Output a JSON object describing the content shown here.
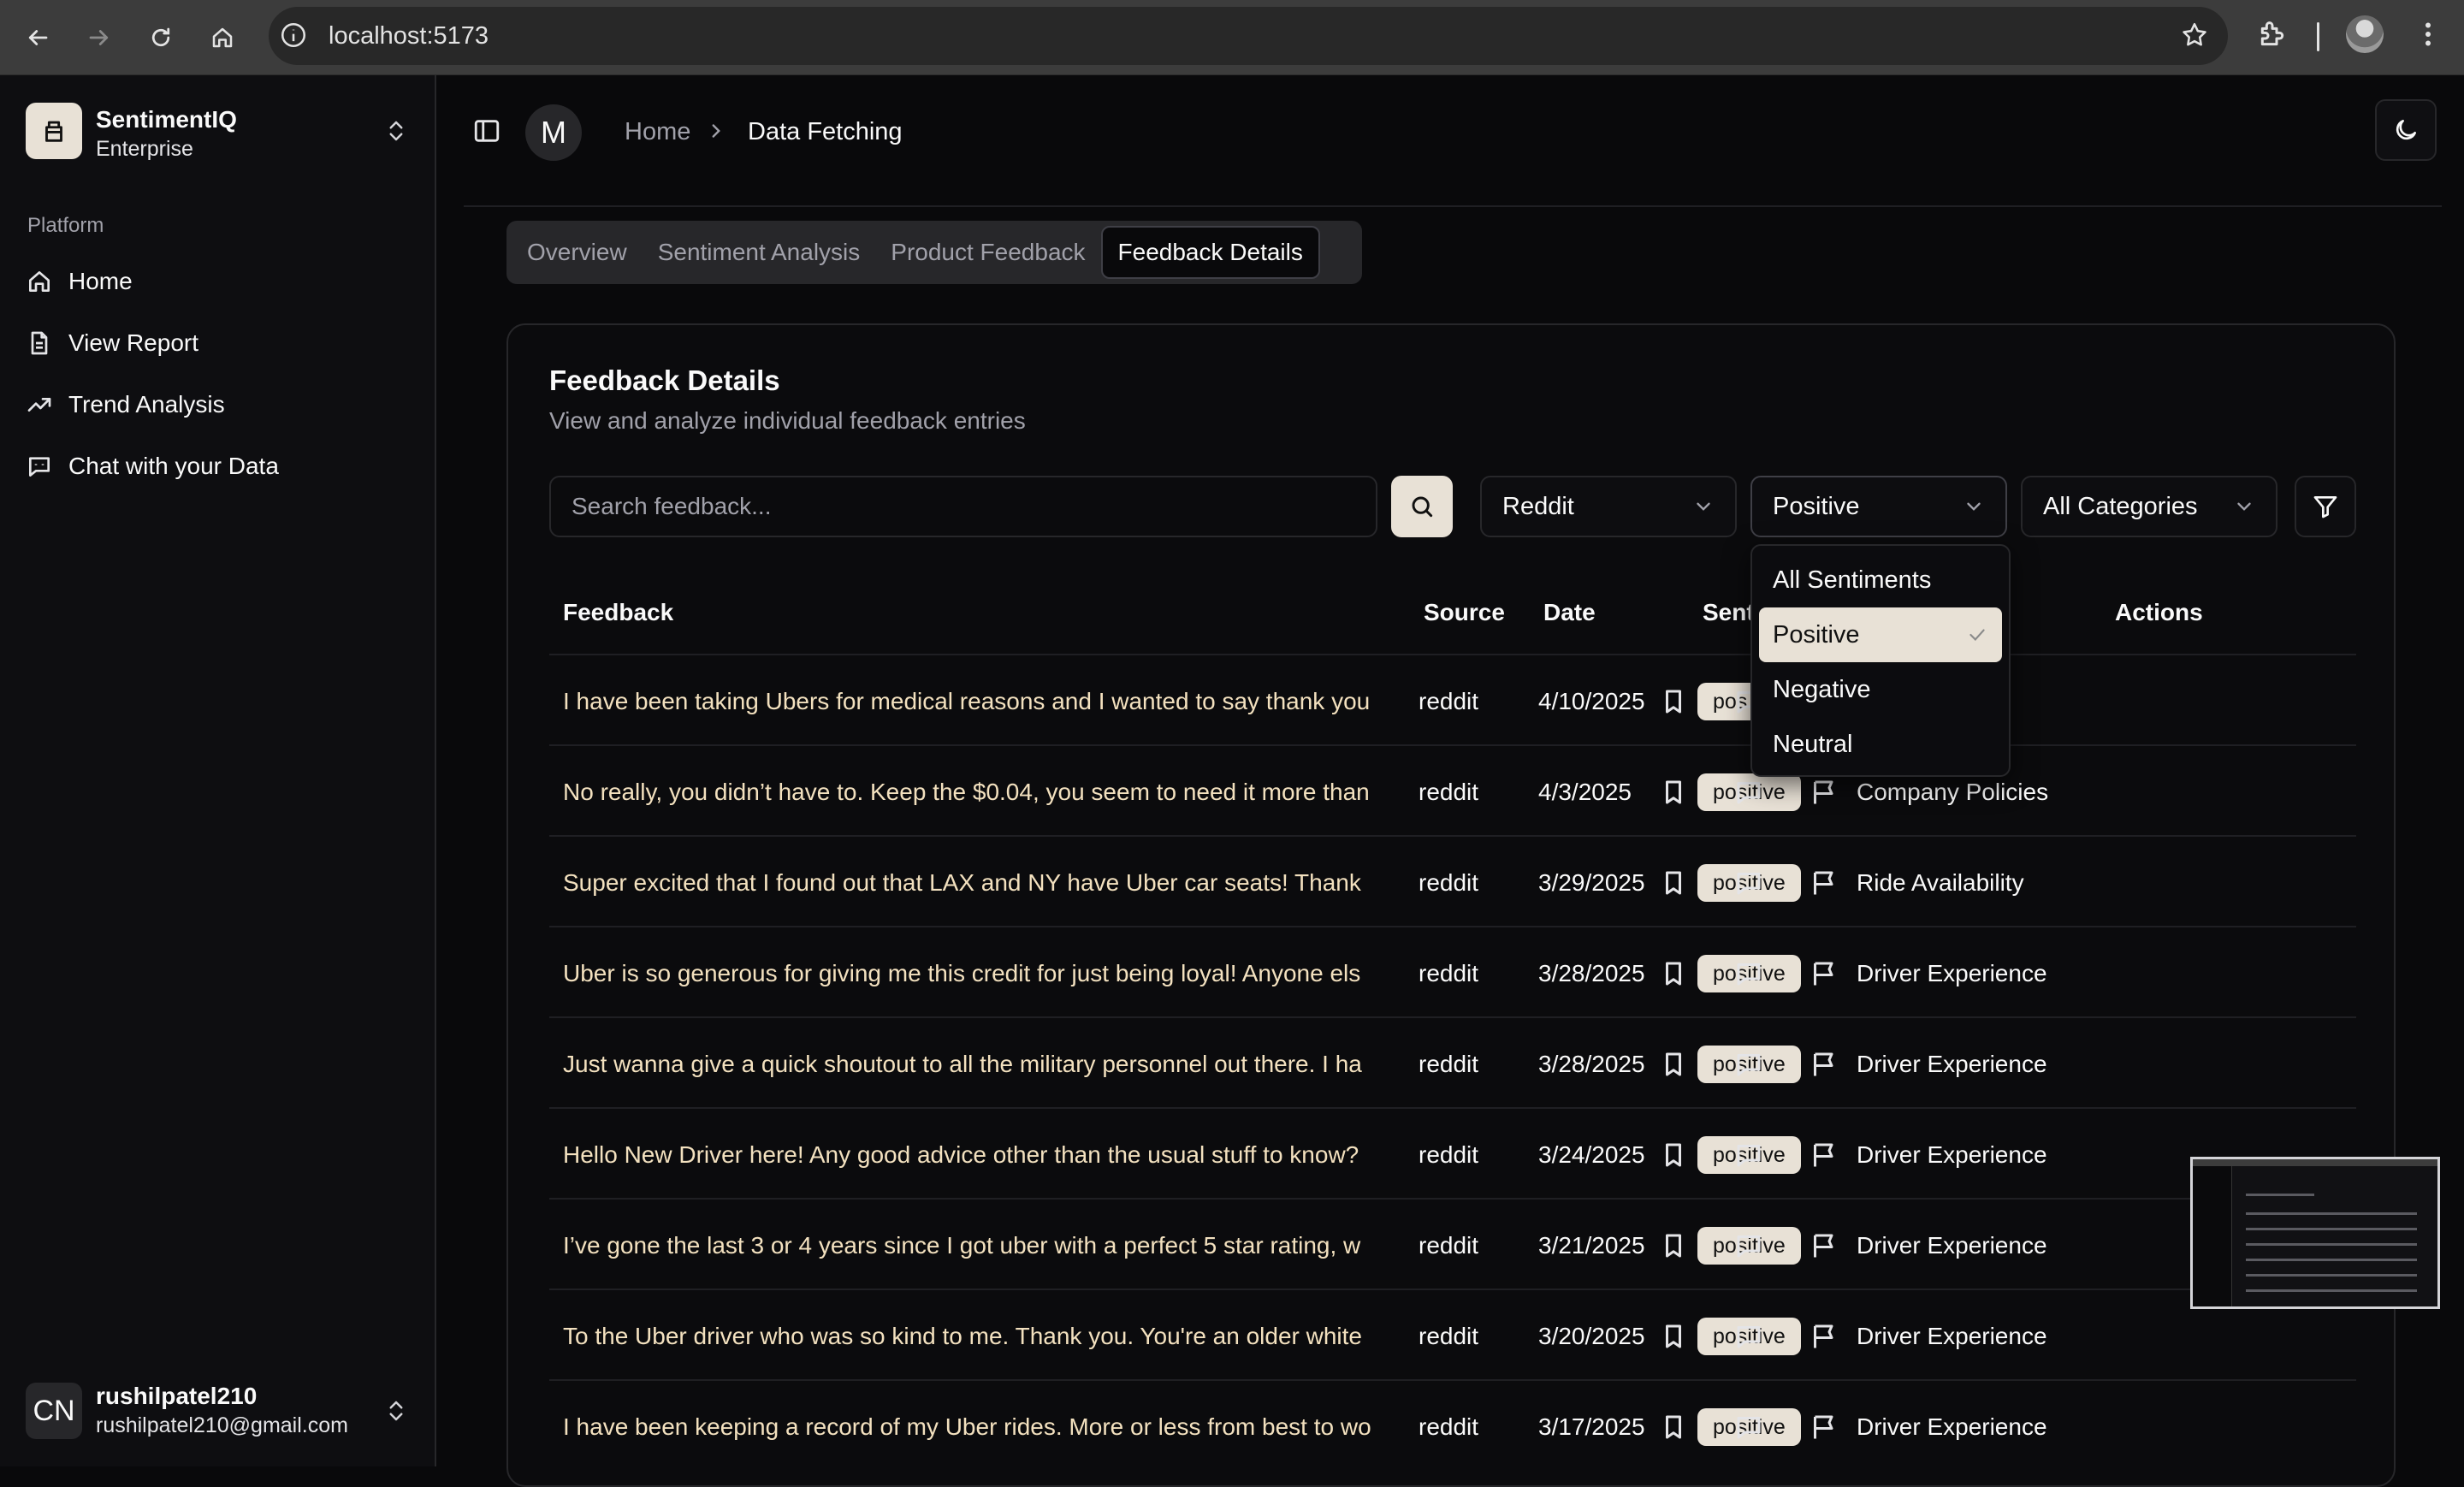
{
  "browser": {
    "url": "localhost:5173"
  },
  "sidebar": {
    "brand_name": "SentimentIQ",
    "brand_plan": "Enterprise",
    "group_label": "Platform",
    "items": [
      {
        "label": "Home",
        "icon": "home-icon"
      },
      {
        "label": "View Report",
        "icon": "file-text-icon"
      },
      {
        "label": "Trend Analysis",
        "icon": "trending-up-icon"
      },
      {
        "label": "Chat with your Data",
        "icon": "bot-message-icon"
      }
    ],
    "user": {
      "initials": "CN",
      "name": "rushilpatel210",
      "email": "rushilpatel210@gmail.com"
    }
  },
  "header": {
    "avatar_letter": "M",
    "breadcrumb_home": "Home",
    "breadcrumb_current": "Data Fetching"
  },
  "tabs": [
    "Overview",
    "Sentiment Analysis",
    "Product Feedback",
    "Feedback Details"
  ],
  "active_tab": "Feedback Details",
  "card": {
    "title": "Feedback Details",
    "subtitle": "View and analyze individual feedback entries"
  },
  "filters": {
    "search_placeholder": "Search feedback...",
    "source": "Reddit",
    "sentiment": "Positive",
    "category": "All Categories"
  },
  "sentiment_dropdown": {
    "options": [
      "All Sentiments",
      "Positive",
      "Negative",
      "Neutral"
    ],
    "selected": "Positive"
  },
  "table": {
    "headers": {
      "feedback": "Feedback",
      "source": "Source",
      "date": "Date",
      "sentiment": "Sent",
      "category_tail": "",
      "actions": "Actions"
    },
    "rows": [
      {
        "feedback": "I have been taking Ubers for medical reasons and I wanted to say thank you",
        "source": "reddit",
        "date": "4/10/2025",
        "sentiment": "pos",
        "category": "ence"
      },
      {
        "feedback": "No really, you didn’t have to. Keep the $0.04, you seem to need it more than",
        "source": "reddit",
        "date": "4/3/2025",
        "sentiment": "positive",
        "category": "Company Policies"
      },
      {
        "feedback": "Super excited that I found out that LAX and NY have Uber car seats! Thank",
        "source": "reddit",
        "date": "3/29/2025",
        "sentiment": "positive",
        "category": "Ride Availability"
      },
      {
        "feedback": "Uber is so generous for giving me this credit for just being loyal! Anyone els",
        "source": "reddit",
        "date": "3/28/2025",
        "sentiment": "positive",
        "category": "Driver Experience"
      },
      {
        "feedback": "Just wanna give a quick shoutout to all the military personnel out there. I ha",
        "source": "reddit",
        "date": "3/28/2025",
        "sentiment": "positive",
        "category": "Driver Experience"
      },
      {
        "feedback": "Hello New Driver here! Any good advice other than the usual stuff to know?",
        "source": "reddit",
        "date": "3/24/2025",
        "sentiment": "positive",
        "category": "Driver Experience"
      },
      {
        "feedback": "I’ve gone the last 3 or 4 years since I got uber with a perfect 5 star rating, w",
        "source": "reddit",
        "date": "3/21/2025",
        "sentiment": "positive",
        "category": "Driver Experience"
      },
      {
        "feedback": "To the Uber driver who was so kind to me. Thank you. You're an older white",
        "source": "reddit",
        "date": "3/20/2025",
        "sentiment": "positive",
        "category": "Driver Experience"
      },
      {
        "feedback": "I have been keeping a record of my Uber rides. More or less from best to wo",
        "source": "reddit",
        "date": "3/17/2025",
        "sentiment": "positive",
        "category": "Driver Experience"
      }
    ]
  },
  "colors": {
    "background": "#09090b",
    "accent": "#e8e1d6",
    "feedback_text": "#f3e1bf",
    "border": "#27272a"
  }
}
